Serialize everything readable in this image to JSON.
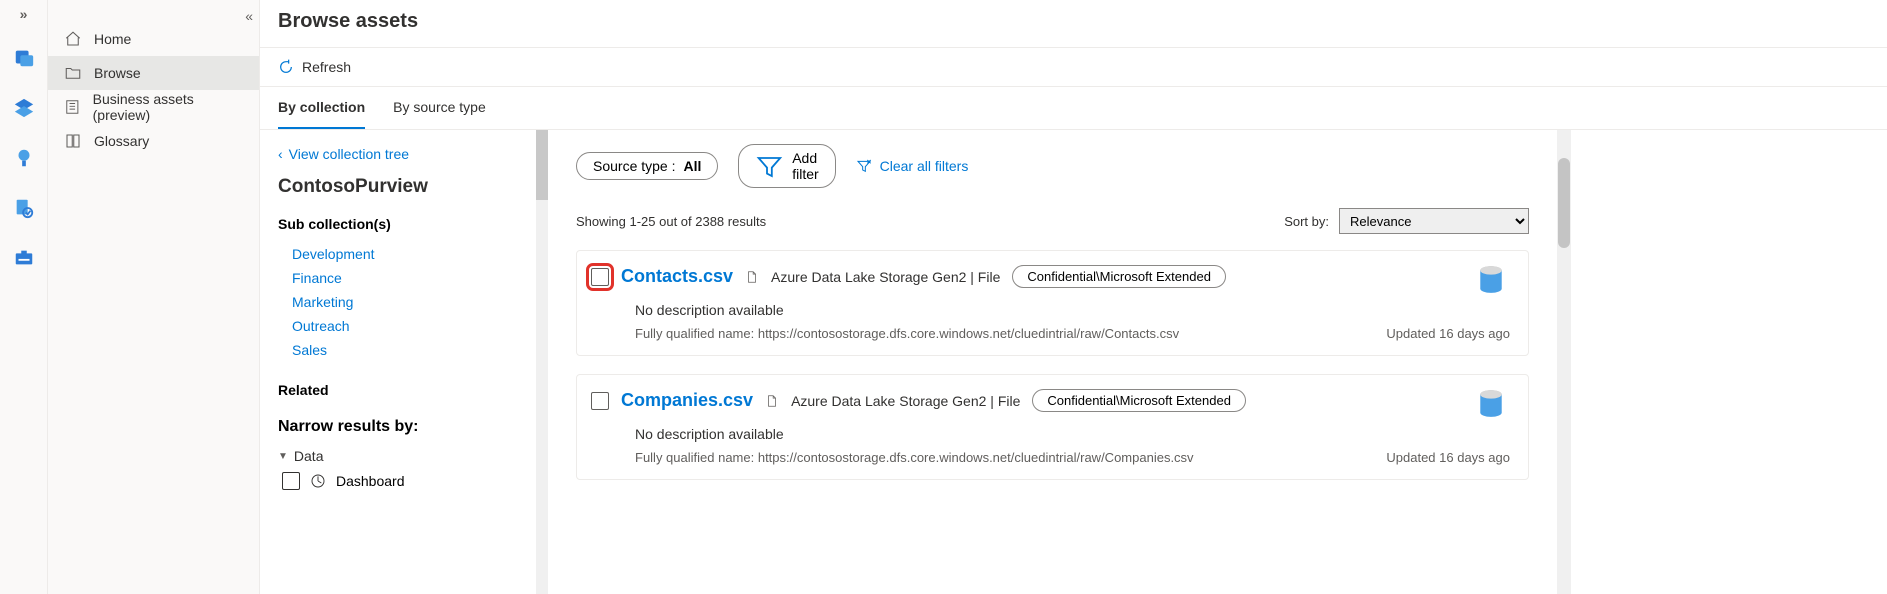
{
  "nav": {
    "items": [
      {
        "label": "Home"
      },
      {
        "label": "Browse"
      },
      {
        "label": "Business assets (preview)"
      },
      {
        "label": "Glossary"
      }
    ]
  },
  "page": {
    "title": "Browse assets",
    "refresh": "Refresh"
  },
  "tabs": {
    "by_collection": "By collection",
    "by_source": "By source type"
  },
  "collection": {
    "view_tree": "View collection tree",
    "name": "ContosoPurview",
    "sub_heading": "Sub collection(s)",
    "subs": [
      "Development",
      "Finance",
      "Marketing",
      "Outreach",
      "Sales"
    ],
    "related": "Related",
    "narrow": "Narrow results by:",
    "facets": {
      "group": "Data",
      "item": "Dashboard"
    }
  },
  "filters": {
    "source_label": "Source type : ",
    "source_value": "All",
    "add": "Add filter",
    "clear": "Clear all filters"
  },
  "meta": {
    "showing": "Showing 1-25 out of 2388 results",
    "sort_label": "Sort by:",
    "sort_value": "Relevance"
  },
  "results": [
    {
      "name": "Contacts.csv",
      "source": "Azure Data Lake Storage Gen2 | File",
      "classification": "Confidential\\Microsoft Extended",
      "description": "No description available",
      "fqn": "Fully qualified name: https://contosostorage.dfs.core.windows.net/cluedintrial/raw/Contacts.csv",
      "updated": "Updated 16 days ago",
      "highlight": true
    },
    {
      "name": "Companies.csv",
      "source": "Azure Data Lake Storage Gen2 | File",
      "classification": "Confidential\\Microsoft Extended",
      "description": "No description available",
      "fqn": "Fully qualified name: https://contosostorage.dfs.core.windows.net/cluedintrial/raw/Companies.csv",
      "updated": "Updated 16 days ago",
      "highlight": false
    }
  ]
}
